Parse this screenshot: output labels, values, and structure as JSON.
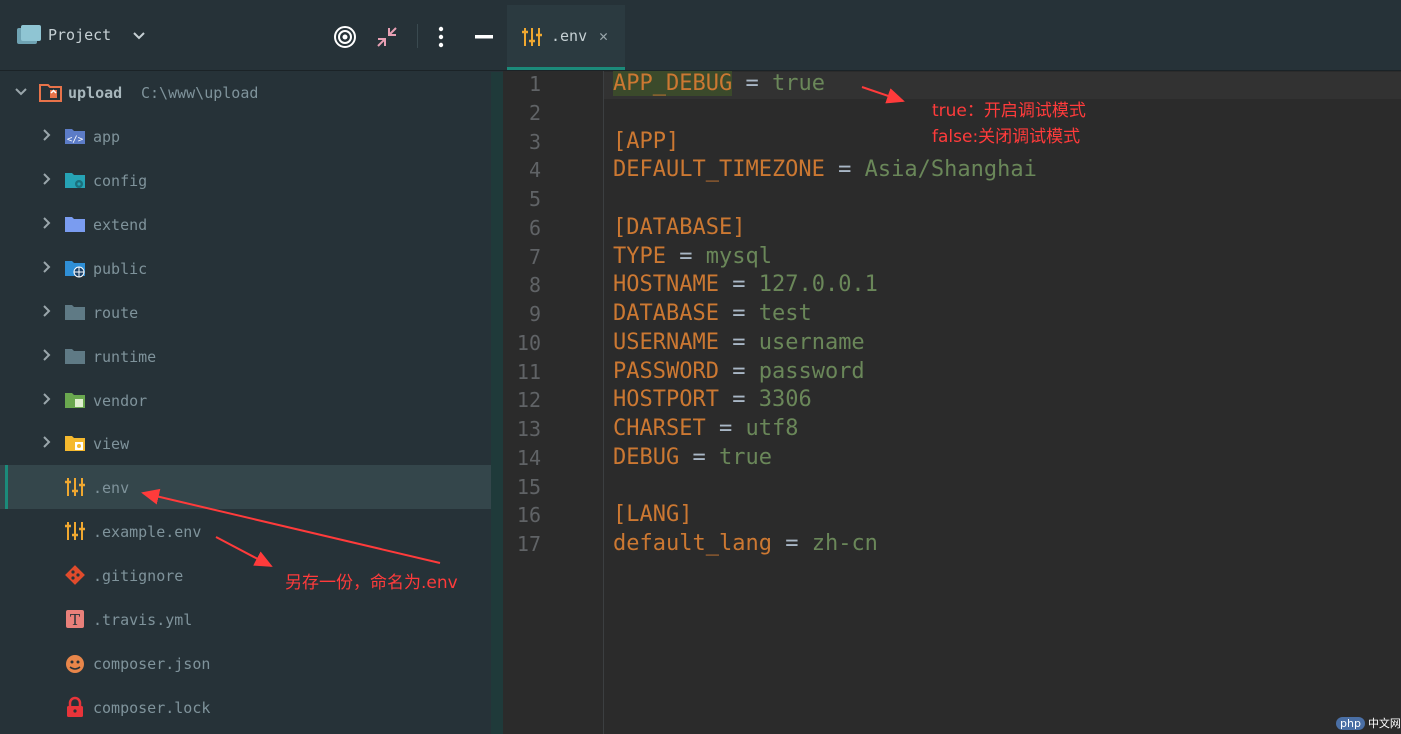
{
  "panel": {
    "title": "Project",
    "root": {
      "name": "upload",
      "path": "C:\\www\\upload"
    },
    "items": [
      {
        "label": "app",
        "type": "folder",
        "icon": "folder-code-icon"
      },
      {
        "label": "config",
        "type": "folder",
        "icon": "folder-config-icon"
      },
      {
        "label": "extend",
        "type": "folder",
        "icon": "folder-icon"
      },
      {
        "label": "public",
        "type": "folder",
        "icon": "folder-web-icon"
      },
      {
        "label": "route",
        "type": "folder",
        "icon": "folder-gray-icon"
      },
      {
        "label": "runtime",
        "type": "folder",
        "icon": "folder-gray-icon"
      },
      {
        "label": "vendor",
        "type": "folder",
        "icon": "folder-vendor-icon"
      },
      {
        "label": "view",
        "type": "folder",
        "icon": "folder-view-icon"
      },
      {
        "label": ".env",
        "type": "file",
        "icon": "env-file-icon",
        "selected": true
      },
      {
        "label": ".example.env",
        "type": "file",
        "icon": "env-file-icon"
      },
      {
        "label": ".gitignore",
        "type": "file",
        "icon": "git-icon"
      },
      {
        "label": ".travis.yml",
        "type": "file",
        "icon": "travis-icon"
      },
      {
        "label": "composer.json",
        "type": "file",
        "icon": "composer-icon"
      },
      {
        "label": "composer.lock",
        "type": "file",
        "icon": "lock-icon"
      }
    ]
  },
  "tab": {
    "label": ".env",
    "close": "✕"
  },
  "editor": {
    "lines": [
      {
        "n": "1",
        "key": "APP_DEBUG",
        "value": "true"
      },
      {
        "n": "2"
      },
      {
        "n": "3",
        "section": "[APP]"
      },
      {
        "n": "4",
        "key": "DEFAULT_TIMEZONE",
        "value": "Asia/Shanghai"
      },
      {
        "n": "5"
      },
      {
        "n": "6",
        "section": "[DATABASE]"
      },
      {
        "n": "7",
        "key": "TYPE",
        "value": "mysql"
      },
      {
        "n": "8",
        "key": "HOSTNAME",
        "value": "127.0.0.1"
      },
      {
        "n": "9",
        "key": "DATABASE",
        "value": "test"
      },
      {
        "n": "10",
        "key": "USERNAME",
        "value": "username"
      },
      {
        "n": "11",
        "key": "PASSWORD",
        "value": "password"
      },
      {
        "n": "12",
        "key": "HOSTPORT",
        "value": "3306"
      },
      {
        "n": "13",
        "key": "CHARSET",
        "value": "utf8"
      },
      {
        "n": "14",
        "key": "DEBUG",
        "value": "true"
      },
      {
        "n": "15"
      },
      {
        "n": "16",
        "section": "[LANG]"
      },
      {
        "n": "17",
        "key": "default_lang",
        "value": "zh-cn"
      }
    ]
  },
  "annotations": {
    "debug_true": "true：开启调试模式",
    "debug_false": "false:关闭调试模式",
    "save_copy": "另存一份，命名为.env"
  },
  "watermark": "中文网",
  "colors": {
    "accent": "#1b8a7a",
    "annotation": "#ff3b3b",
    "key": "#cc7832",
    "value": "#6a8759"
  }
}
